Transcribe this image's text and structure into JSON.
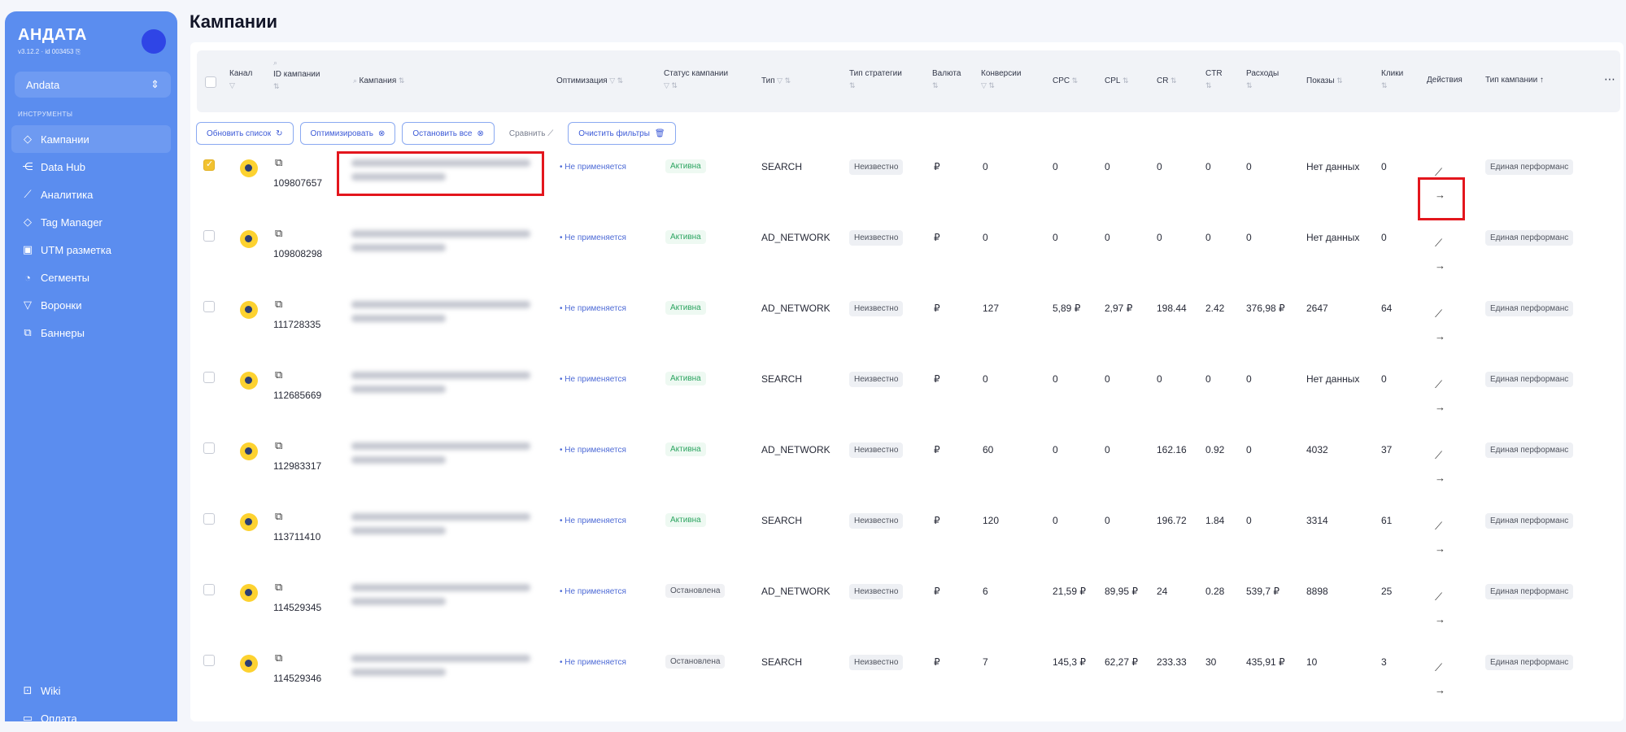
{
  "sidebar": {
    "brand": "АНДАТА",
    "meta": "v3.12.2 · id 003453 ⎘",
    "workspace": "Andata",
    "section": "ИНСТРУМЕНТЫ",
    "items": [
      {
        "label": "Кампании",
        "icon": "tag-icon"
      },
      {
        "label": "Data Hub",
        "icon": "share-icon"
      },
      {
        "label": "Аналитика",
        "icon": "chart-icon"
      },
      {
        "label": "Tag Manager",
        "icon": "diamond-icon"
      },
      {
        "label": "UTM разметка",
        "icon": "utm-icon"
      },
      {
        "label": "Сегменты",
        "icon": "segments-icon"
      },
      {
        "label": "Воронки",
        "icon": "funnel-icon"
      },
      {
        "label": "Баннеры",
        "icon": "banners-icon"
      }
    ],
    "bottom": [
      {
        "label": "Wiki",
        "icon": "book-icon"
      },
      {
        "label": "Оплата",
        "icon": "wallet-icon"
      }
    ]
  },
  "page": {
    "title": "Кампании"
  },
  "table": {
    "headers": {
      "channel": "Канал",
      "id": "ID кампании",
      "campaign": "Кампания",
      "optimization": "Оптимизация",
      "status_l1": "Статус кампании",
      "type": "Тип",
      "strategy": "Тип стратегии",
      "currency": "Валюта",
      "conversions": "Конверсии",
      "cpc": "CPC",
      "cpl": "CPL",
      "cr": "CR",
      "ctr": "CTR",
      "spend": "Расходы",
      "impressions": "Показы",
      "clicks": "Клики",
      "actions": "Действия",
      "campaign_type": "Тип кампании",
      "more": "⋯"
    },
    "toolbar": {
      "refresh": "Обновить список",
      "optimize": "Оптимизировать",
      "stop_all": "Остановить все",
      "compare": "Сравнить",
      "clear_filters": "Очистить фильтры"
    },
    "rows": [
      {
        "id": "109807657",
        "opt": "• Не применяется",
        "status": "Активна",
        "status_kind": "active",
        "type": "SEARCH",
        "strategy": "Неизвестно",
        "currency": "₽",
        "conv": "0",
        "cpc": "0",
        "cpl": "0",
        "cr": "0",
        "ctr": "0",
        "spend": "0",
        "impr": "Нет данных",
        "clicks": "0",
        "ctype": "Единая перформанс",
        "checked": true
      },
      {
        "id": "109808298",
        "opt": "• Не применяется",
        "status": "Активна",
        "status_kind": "active",
        "type": "AD_NETWORK",
        "strategy": "Неизвестно",
        "currency": "₽",
        "conv": "0",
        "cpc": "0",
        "cpl": "0",
        "cr": "0",
        "ctr": "0",
        "spend": "0",
        "impr": "Нет данных",
        "clicks": "0",
        "ctype": "Единая перформанс",
        "checked": false
      },
      {
        "id": "111728335",
        "opt": "• Не применяется",
        "status": "Активна",
        "status_kind": "active",
        "type": "AD_NETWORK",
        "strategy": "Неизвестно",
        "currency": "₽",
        "conv": "127",
        "cpc": "5,89 ₽",
        "cpl": "2,97 ₽",
        "cr": "198.44",
        "ctr": "2.42",
        "spend": "376,98 ₽",
        "impr": "2647",
        "clicks": "64",
        "ctype": "Единая перформанс",
        "checked": false
      },
      {
        "id": "112685669",
        "opt": "• Не применяется",
        "status": "Активна",
        "status_kind": "active",
        "type": "SEARCH",
        "strategy": "Неизвестно",
        "currency": "₽",
        "conv": "0",
        "cpc": "0",
        "cpl": "0",
        "cr": "0",
        "ctr": "0",
        "spend": "0",
        "impr": "Нет данных",
        "clicks": "0",
        "ctype": "Единая перформанс",
        "checked": false
      },
      {
        "id": "112983317",
        "opt": "• Не применяется",
        "status": "Активна",
        "status_kind": "active",
        "type": "AD_NETWORK",
        "strategy": "Неизвестно",
        "currency": "₽",
        "conv": "60",
        "cpc": "0",
        "cpl": "0",
        "cr": "162.16",
        "ctr": "0.92",
        "spend": "0",
        "impr": "4032",
        "clicks": "37",
        "ctype": "Единая перформанс",
        "checked": false
      },
      {
        "id": "113711410",
        "opt": "• Не применяется",
        "status": "Активна",
        "status_kind": "active",
        "type": "SEARCH",
        "strategy": "Неизвестно",
        "currency": "₽",
        "conv": "120",
        "cpc": "0",
        "cpl": "0",
        "cr": "196.72",
        "ctr": "1.84",
        "spend": "0",
        "impr": "3314",
        "clicks": "61",
        "ctype": "Единая перформанс",
        "checked": false
      },
      {
        "id": "114529345",
        "opt": "• Не применяется",
        "status": "Остановлена",
        "status_kind": "stopped",
        "type": "AD_NETWORK",
        "strategy": "Неизвестно",
        "currency": "₽",
        "conv": "6",
        "cpc": "21,59 ₽",
        "cpl": "89,95 ₽",
        "cr": "24",
        "ctr": "0.28",
        "spend": "539,7 ₽",
        "impr": "8898",
        "clicks": "25",
        "ctype": "Единая перформанс",
        "checked": false
      },
      {
        "id": "114529346",
        "opt": "• Не применяется",
        "status": "Остановлена",
        "status_kind": "stopped",
        "type": "SEARCH",
        "strategy": "Неизвестно",
        "currency": "₽",
        "conv": "7",
        "cpc": "145,3 ₽",
        "cpl": "62,27 ₽",
        "cr": "233.33",
        "ctr": "30",
        "spend": "435,91 ₽",
        "impr": "10",
        "clicks": "3",
        "ctype": "Единая перформанс",
        "checked": false
      }
    ]
  },
  "colors": {
    "sidebar": "#5b8def",
    "accent": "#3c5ad7",
    "highlight": "#e3161d",
    "active_status": "#2da561"
  }
}
